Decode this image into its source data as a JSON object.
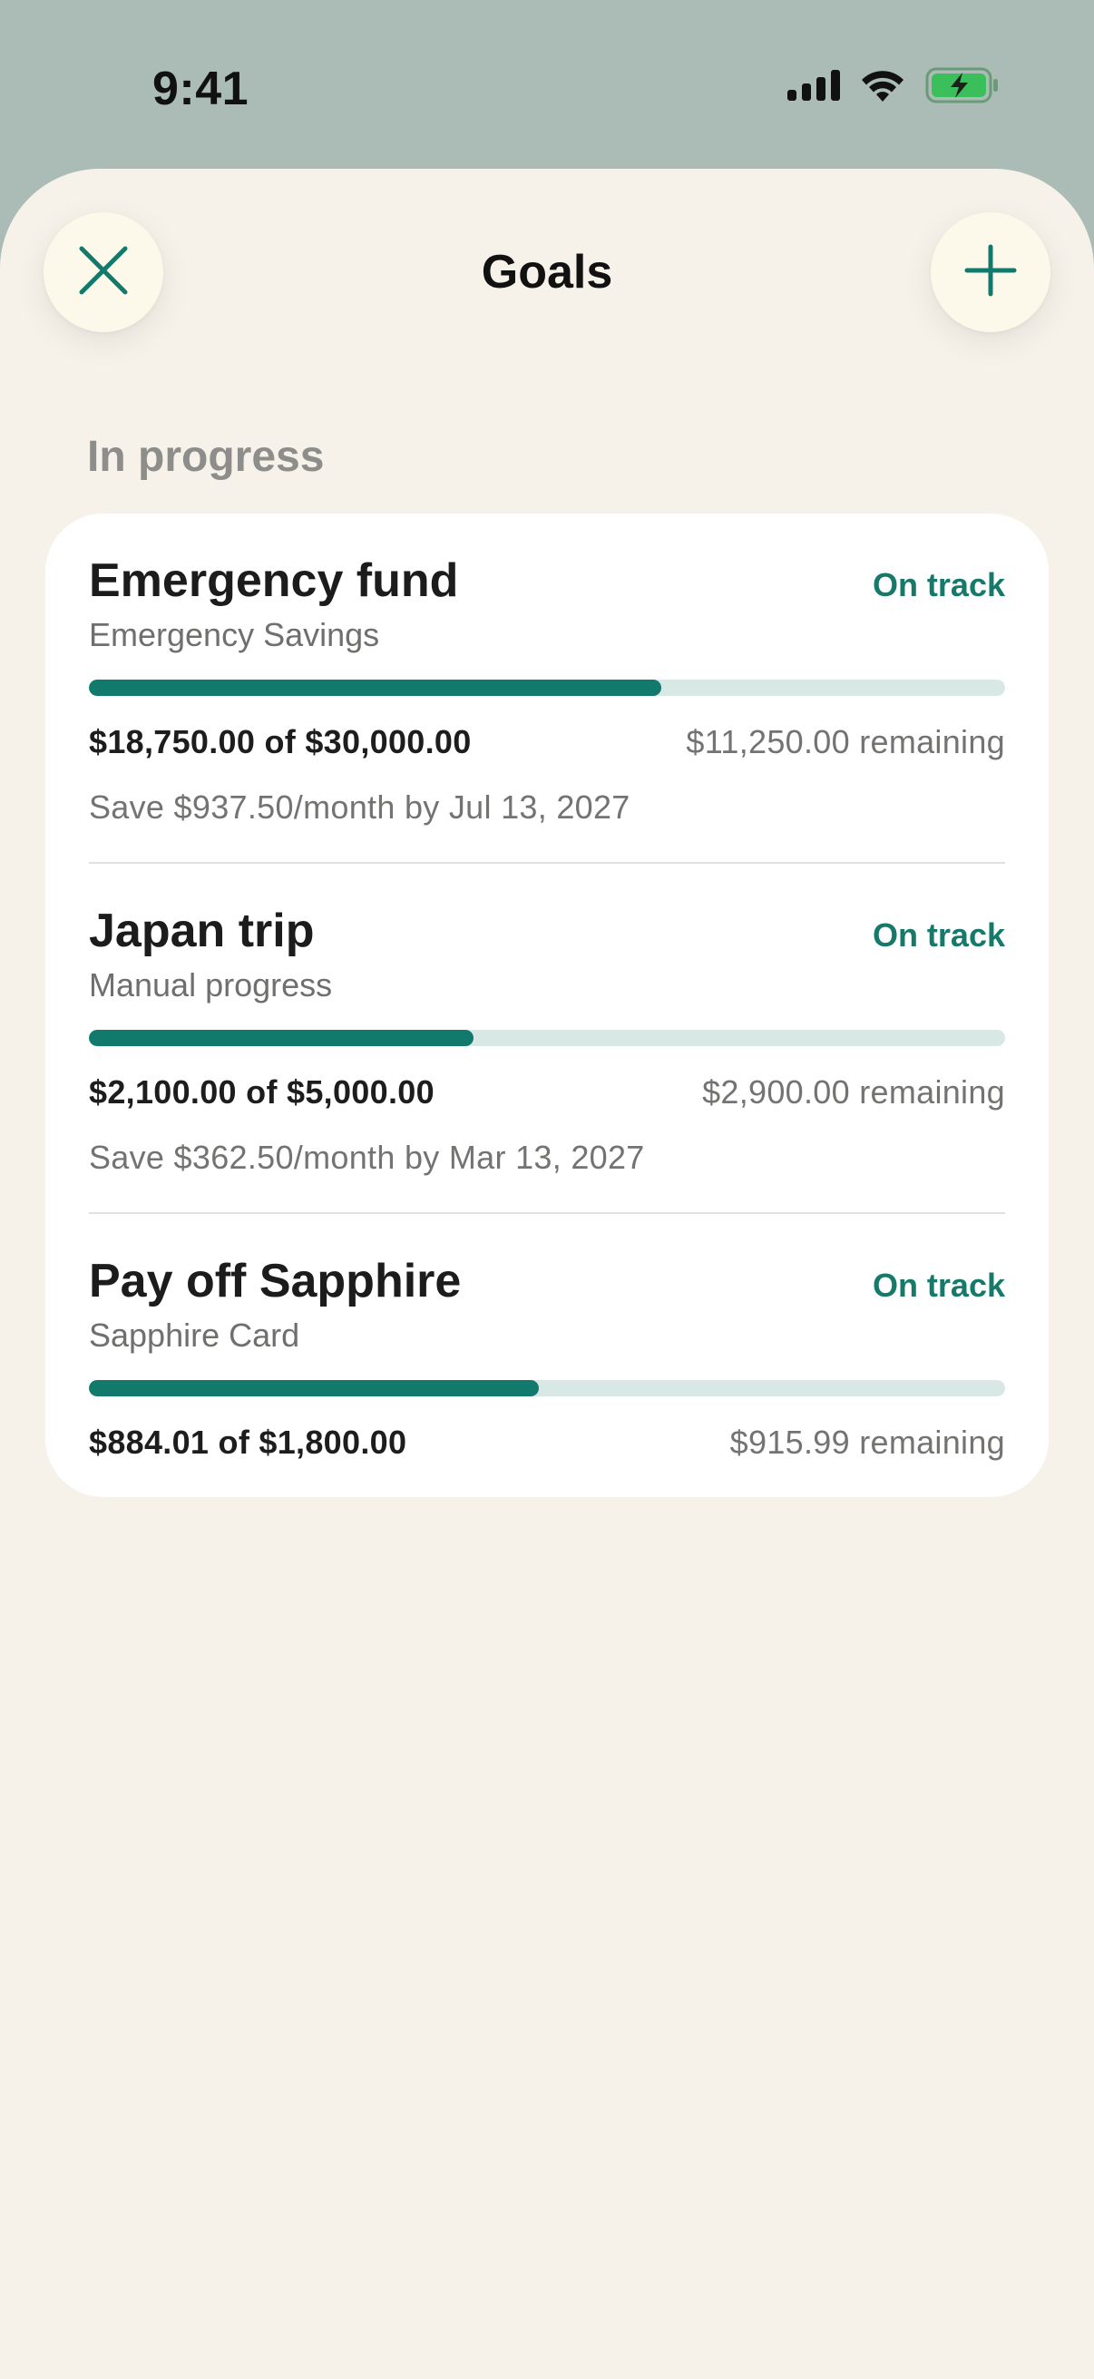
{
  "status_bar": {
    "time": "9:41"
  },
  "header": {
    "title": "Goals",
    "close_icon": "close-icon",
    "add_icon": "plus-icon"
  },
  "section": {
    "label": "In progress"
  },
  "colors": {
    "accent": "#127a6c",
    "track": "#d8e9e5",
    "background": "#f6f2ea",
    "top_background": "#abbbb6"
  },
  "goals": [
    {
      "name": "Emergency fund",
      "status": "On track",
      "account": "Emergency Savings",
      "progress_fraction": 0.625,
      "amount": "$18,750.00 of $30,000.00",
      "remaining": "$11,250.00 remaining",
      "plan": "Save $937.50/month by Jul 13, 2027"
    },
    {
      "name": "Japan trip",
      "status": "On track",
      "account": "Manual progress",
      "progress_fraction": 0.42,
      "amount": "$2,100.00 of $5,000.00",
      "remaining": "$2,900.00 remaining",
      "plan": "Save $362.50/month by Mar 13, 2027"
    },
    {
      "name": "Pay off Sapphire",
      "status": "On track",
      "account": "Sapphire Card",
      "progress_fraction": 0.491,
      "amount": "$884.01 of $1,800.00",
      "remaining": "$915.99 remaining"
    }
  ]
}
